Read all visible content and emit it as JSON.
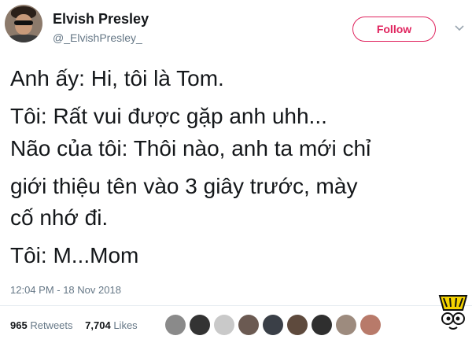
{
  "tweet": {
    "author_name": "Elvish Presley",
    "handle": "@_ElvishPresley_",
    "follow_label": "Follow",
    "lines": [
      "Anh ấy: Hi, tôi là Tom.",
      "Tôi: Rất vui được gặp anh uhh...",
      "Não của tôi: Thôi nào, anh ta mới chỉ",
      "giới thiệu tên vào 3 giây trước, mày",
      "cố nhớ đi.",
      "Tôi: M...Mom"
    ],
    "timestamp": "12:04 PM - 18 Nov 2018",
    "retweets_count": "965",
    "retweets_label": "Retweets",
    "likes_count": "7,704",
    "likes_label": "Likes"
  },
  "colors": {
    "follow_accent": "#e0245e",
    "meta_gray": "#657786",
    "text": "#14171a",
    "logo_yellow": "#f5d300"
  },
  "icons": [
    "avatar",
    "chevron-down-icon",
    "liker-avatars",
    "watermark-logo"
  ]
}
